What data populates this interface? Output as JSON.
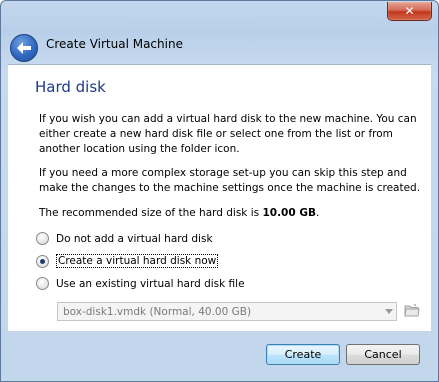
{
  "window": {
    "close_glyph": "✕"
  },
  "nav": {
    "title": "Create Virtual Machine",
    "back_icon": "back-arrow-icon"
  },
  "page": {
    "heading": "Hard disk",
    "paragraph1": "If you wish you can add a virtual hard disk to the new machine. You can either create a new hard disk file or select one from the list or from another location using the folder icon.",
    "paragraph2": "If you need a more complex storage set-up you can skip this step and make the changes to the machine settings once the machine is created.",
    "recommended_prefix": "The recommended size of the hard disk is ",
    "recommended_size": "10.00 GB",
    "recommended_suffix": "."
  },
  "options": [
    {
      "label": "Do not add a virtual hard disk",
      "selected": false
    },
    {
      "label": "Create a virtual hard disk now",
      "selected": true
    },
    {
      "label": "Use an existing virtual hard disk file",
      "selected": false
    }
  ],
  "existing_disk": {
    "value": "box-disk1.vmdk (Normal, 40.00 GB)",
    "enabled": false
  },
  "buttons": {
    "create": "Create",
    "cancel": "Cancel"
  }
}
